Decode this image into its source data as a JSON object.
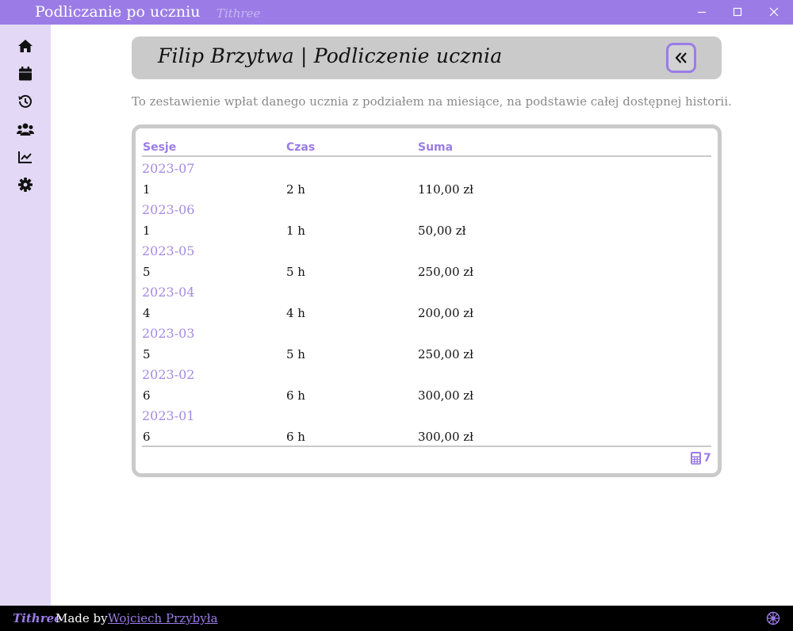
{
  "window": {
    "title": "Podliczanie po uczniu",
    "brand": "Tithree"
  },
  "sidebar": {
    "items": [
      {
        "icon": "home-icon"
      },
      {
        "icon": "calendar-icon"
      },
      {
        "icon": "history-icon"
      },
      {
        "icon": "users-icon"
      },
      {
        "icon": "chart-icon"
      },
      {
        "icon": "gear-icon"
      }
    ]
  },
  "header": {
    "title": "Filip Brzytwa | Podliczenie ucznia"
  },
  "description": "To zestawienie wpłat danego ucznia z podziałem na miesiące, na podstawie całej dostępnej historii.",
  "table": {
    "columns": [
      "Sesje",
      "Czas",
      "Suma"
    ],
    "groups": [
      {
        "month": "2023-07",
        "sessions": "1",
        "time": "2 h",
        "sum": "110,00 zł"
      },
      {
        "month": "2023-06",
        "sessions": "1",
        "time": "1 h",
        "sum": "50,00 zł"
      },
      {
        "month": "2023-05",
        "sessions": "5",
        "time": "5 h",
        "sum": "250,00 zł"
      },
      {
        "month": "2023-04",
        "sessions": "4",
        "time": "4 h",
        "sum": "200,00 zł"
      },
      {
        "month": "2023-03",
        "sessions": "5",
        "time": "5 h",
        "sum": "250,00 zł"
      },
      {
        "month": "2023-02",
        "sessions": "6",
        "time": "6 h",
        "sum": "300,00 zł"
      },
      {
        "month": "2023-01",
        "sessions": "6",
        "time": "6 h",
        "sum": "300,00 zł"
      }
    ],
    "footer_count": "7"
  },
  "footer": {
    "brand": "Tithree",
    "made_by": "Made by",
    "author": "Wojciech Przybyła"
  },
  "colors": {
    "accent": "#9b7ce6",
    "sidebar_bg": "#e3d9f6",
    "card_gray": "#cacaca"
  }
}
